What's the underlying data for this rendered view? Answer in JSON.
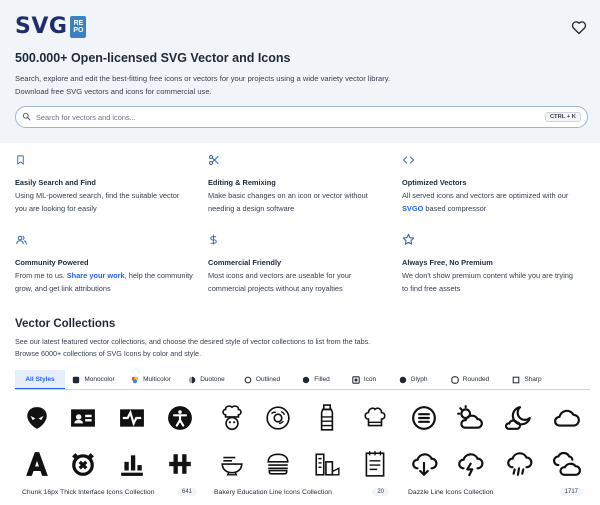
{
  "brand": {
    "name": "SVG",
    "badge_l1": "RE",
    "badge_l2": "PO"
  },
  "hero": {
    "title": "500.000+ Open-licensed SVG Vector and Icons",
    "desc_line1": "Search, explore and edit the best-fitting free icons or vectors for your projects using a wide variety vector library.",
    "desc_line2": "Download free SVG vectors and icons for commercial use."
  },
  "search": {
    "placeholder": "Search for vectors and icons...",
    "shortcut": "CTRL + K"
  },
  "features": [
    {
      "icon": "bookmark-icon",
      "title": "Easily Search and Find",
      "line1": "Using ML-powered search, find the suitable vector",
      "line2": "you are looking for easily"
    },
    {
      "icon": "scissors-icon",
      "title": "Editing & Remixing",
      "line1": "Make basic changes on an icon or vector without",
      "line2": "needing a design software"
    },
    {
      "icon": "code-icon",
      "title": "Optimized Vectors",
      "line1": "All served icons and vectors are optimized with our",
      "line2_link": "SVGO",
      "line2_rest": " based compressor"
    },
    {
      "icon": "users-icon",
      "title": "Community Powered",
      "line1_pre": "From me to us. ",
      "line1_link": "Share your work",
      "line1_post": ", help the community",
      "line2": "grow, and get link attributions"
    },
    {
      "icon": "dollar-icon",
      "title": "Commercial Friendly",
      "line1": "Most icons and vectors are useable for your",
      "line2": "commercial projects without any royalties"
    },
    {
      "icon": "star-icon",
      "title": "Always Free, No Premium",
      "line1": "We don't show premium content while you are trying",
      "line2": "to find free assets"
    }
  ],
  "collections": {
    "title": "Vector Collections",
    "desc_line1": "See our latest featured vector collections, and choose the desired style of vector collections to list from the tabs.",
    "desc_line2": "Browse 6000+ collections of SVG Icons by color and style.",
    "tabs": [
      {
        "label": "All Styles",
        "icon": "",
        "active": true
      },
      {
        "label": "Monocolor",
        "icon": "monocolor-icon"
      },
      {
        "label": "Multicolor",
        "icon": "multicolor-icon"
      },
      {
        "label": "Duotone",
        "icon": "duotone-icon"
      },
      {
        "label": "Outlined",
        "icon": "outlined-icon"
      },
      {
        "label": "Filled",
        "icon": "filled-icon"
      },
      {
        "label": "Icon",
        "icon": "icon-style-icon"
      },
      {
        "label": "Glyph",
        "icon": "glyph-icon"
      },
      {
        "label": "Rounded",
        "icon": "rounded-icon"
      },
      {
        "label": "Sharp",
        "icon": "sharp-icon"
      }
    ],
    "items": [
      {
        "name": "Chunk 16px Thick Interface Icons Collection",
        "count": "641"
      },
      {
        "name": "Bakery Education Line Icons Collection",
        "count": "20"
      },
      {
        "name": "Dazzle Line Icons Collection",
        "count": "1717"
      }
    ]
  },
  "colors": {
    "accent": "#2563eb",
    "brand": "#1e2f6b",
    "hero_bg": "#f1f5f9"
  }
}
